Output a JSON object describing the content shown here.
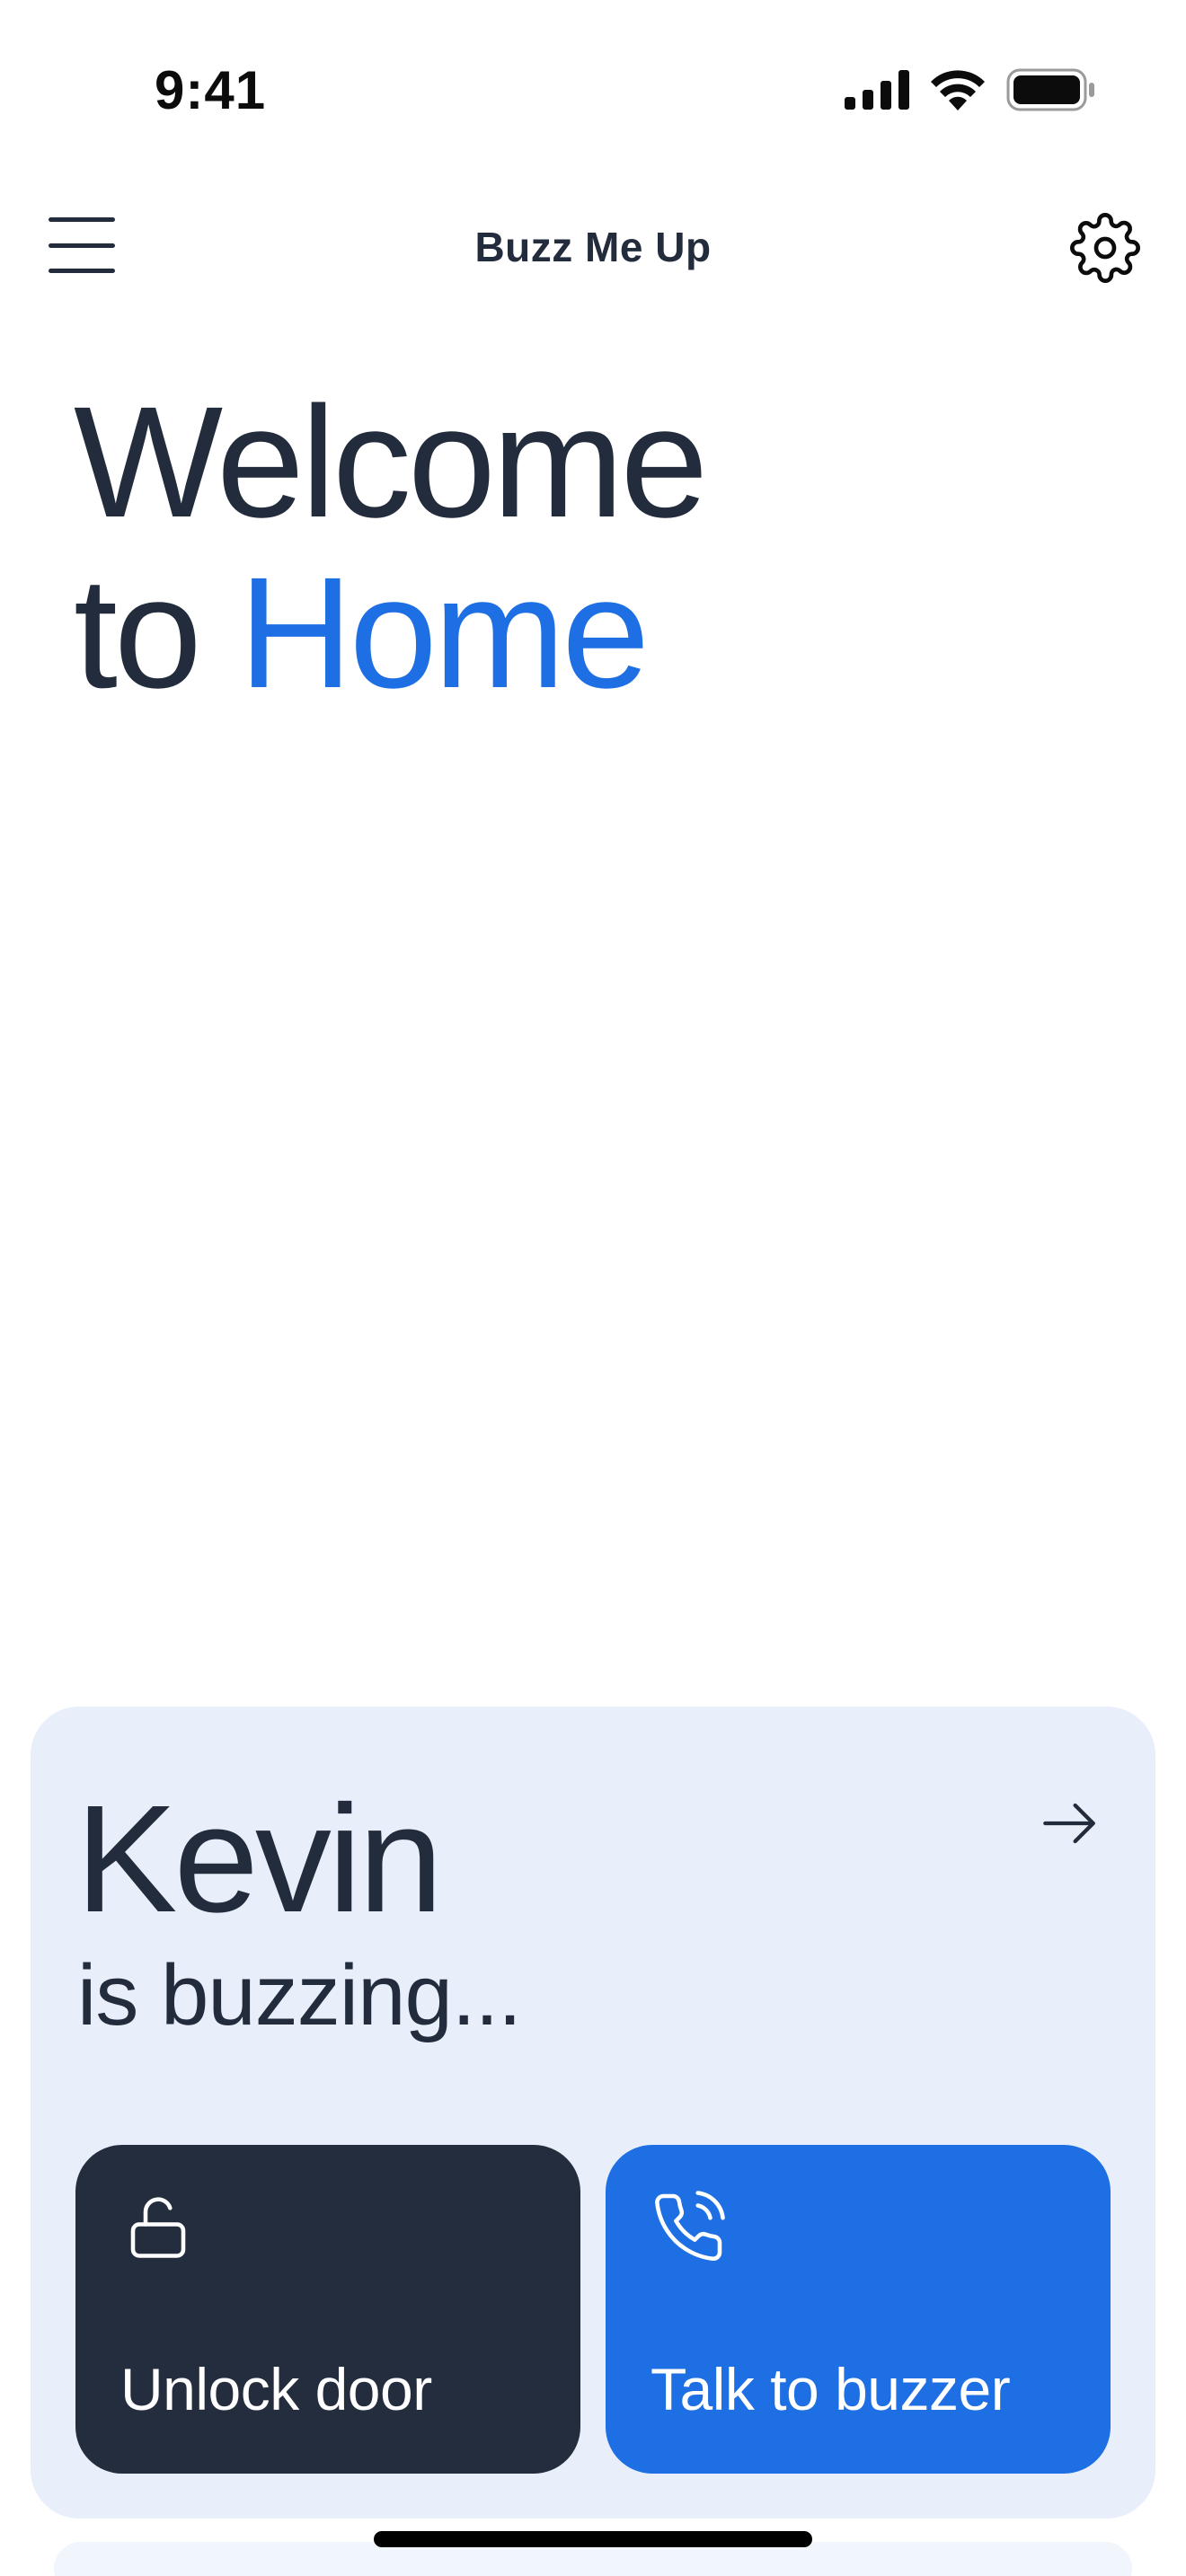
{
  "status_bar": {
    "time": "9:41",
    "signal_icon": "cellular-signal-icon",
    "wifi_icon": "wifi-icon",
    "battery_icon": "battery-icon"
  },
  "nav": {
    "title": "Buzz Me Up",
    "menu_icon": "hamburger-menu-icon",
    "settings_icon": "gear-icon"
  },
  "welcome": {
    "line1": "Welcome",
    "line2_prefix": "to",
    "line2_accent": "Home"
  },
  "buzz": {
    "caller": "Kevin",
    "status": "is buzzing...",
    "open_icon": "arrow-right-icon",
    "unlock_label": "Unlock door",
    "unlock_icon": "unlock-icon",
    "talk_label": "Talk to buzzer",
    "talk_icon": "phone-ringing-icon"
  },
  "colors": {
    "text_primary": "#232c3c",
    "accent": "#1e6fe3",
    "card_background": "#e8effb",
    "dark_button": "#242d3e"
  }
}
